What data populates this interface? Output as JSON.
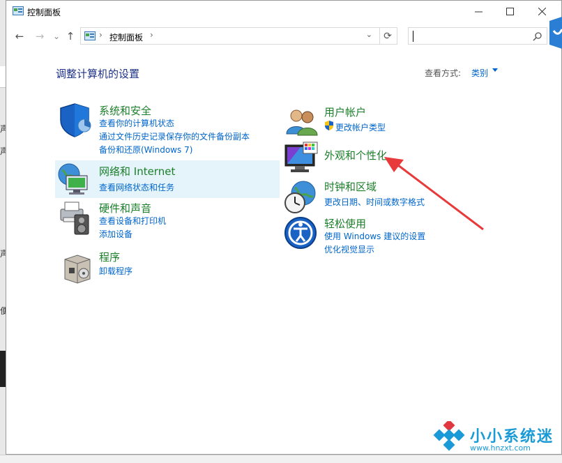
{
  "window": {
    "title": "控制面板",
    "minimize_icon": "minimize-icon",
    "maximize_icon": "maximize-icon",
    "close_icon": "close-icon"
  },
  "nav": {
    "back": "←",
    "forward": "→",
    "recent": "⌄",
    "up": "↑",
    "breadcrumb": [
      "控制面板"
    ],
    "refresh": "⟳"
  },
  "search": {
    "placeholder": "",
    "value": ""
  },
  "main": {
    "heading": "调整计算机的设置",
    "view_by_label": "查看方式:",
    "view_by_value": "类别"
  },
  "categories": [
    {
      "title": "系统和安全",
      "icon": "shield-icon",
      "links": [
        "查看你的计算机状态",
        "通过文件历史记录保存你的文件备份副本",
        "备份和还原(Windows 7)"
      ]
    },
    {
      "title": "网络和 Internet",
      "icon": "network-globe-icon",
      "links": [
        "查看网络状态和任务"
      ]
    },
    {
      "title": "硬件和声音",
      "icon": "printer-speaker-icon",
      "links": [
        "查看设备和打印机",
        "添加设备"
      ]
    },
    {
      "title": "程序",
      "icon": "programs-box-icon",
      "links": [
        "卸载程序"
      ]
    },
    {
      "title": "用户帐户",
      "icon": "users-icon",
      "links": [
        "更改帐户类型"
      ]
    },
    {
      "title": "外观和个性化",
      "icon": "monitor-palette-icon",
      "links": []
    },
    {
      "title": "时钟和区域",
      "icon": "clock-globe-icon",
      "links": [
        "更改日期、时间或数字格式"
      ]
    },
    {
      "title": "轻松使用",
      "icon": "ease-of-access-icon",
      "links": [
        "使用 Windows 建议的设置",
        "优化视觉显示"
      ]
    }
  ],
  "watermark": {
    "text": "小小系统迷",
    "url": "www.hnzxt.com"
  },
  "colors": {
    "heading": "#1e3287",
    "category_title": "#1b7f2a",
    "link": "#0066cc",
    "highlight": "#e5f3fb",
    "arrow": "#e83a3a"
  }
}
